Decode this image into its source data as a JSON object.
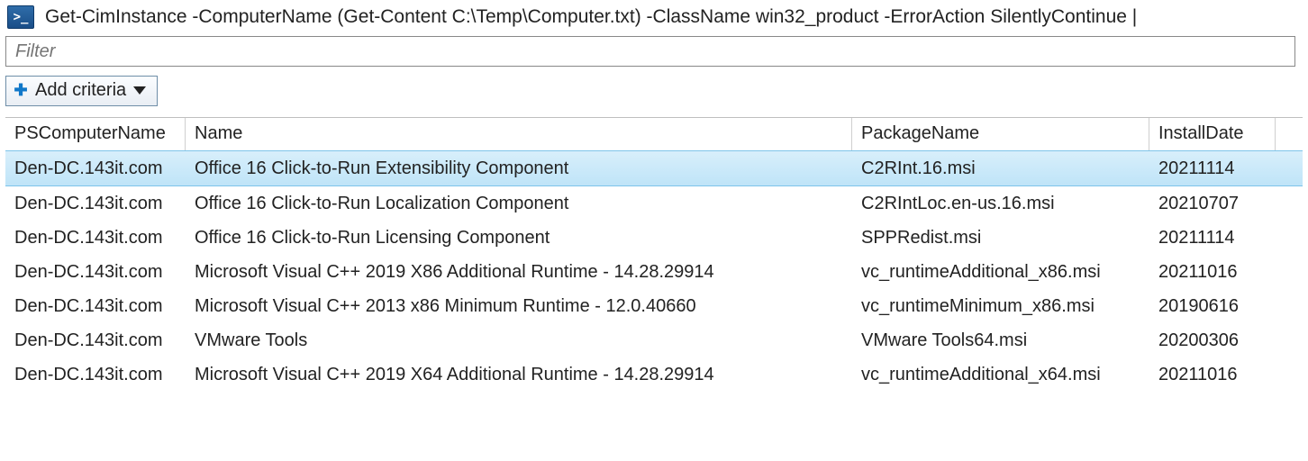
{
  "header": {
    "command": "Get-CimInstance -ComputerName (Get-Content C:\\Temp\\Computer.txt) -ClassName win32_product -ErrorAction SilentlyContinue |"
  },
  "filter": {
    "placeholder": "Filter",
    "value": ""
  },
  "criteria_button": {
    "label": "Add criteria"
  },
  "columns": [
    "PSComputerName",
    "Name",
    "PackageName",
    "InstallDate"
  ],
  "rows": [
    {
      "selected": true,
      "PSComputerName": "Den-DC.143it.com",
      "Name": "Office 16 Click-to-Run Extensibility Component",
      "PackageName": "C2RInt.16.msi",
      "InstallDate": "20211114"
    },
    {
      "selected": false,
      "PSComputerName": "Den-DC.143it.com",
      "Name": "Office 16 Click-to-Run Localization Component",
      "PackageName": "C2RIntLoc.en-us.16.msi",
      "InstallDate": "20210707"
    },
    {
      "selected": false,
      "PSComputerName": "Den-DC.143it.com",
      "Name": "Office 16 Click-to-Run Licensing Component",
      "PackageName": "SPPRedist.msi",
      "InstallDate": "20211114"
    },
    {
      "selected": false,
      "PSComputerName": "Den-DC.143it.com",
      "Name": "Microsoft Visual C++ 2019 X86 Additional Runtime - 14.28.29914",
      "PackageName": "vc_runtimeAdditional_x86.msi",
      "InstallDate": "20211016"
    },
    {
      "selected": false,
      "PSComputerName": "Den-DC.143it.com",
      "Name": "Microsoft Visual C++ 2013 x86 Minimum Runtime - 12.0.40660",
      "PackageName": "vc_runtimeMinimum_x86.msi",
      "InstallDate": "20190616"
    },
    {
      "selected": false,
      "PSComputerName": "Den-DC.143it.com",
      "Name": "VMware Tools",
      "PackageName": "VMware Tools64.msi",
      "InstallDate": "20200306"
    },
    {
      "selected": false,
      "PSComputerName": "Den-DC.143it.com",
      "Name": "Microsoft Visual C++ 2019 X64 Additional Runtime - 14.28.29914",
      "PackageName": "vc_runtimeAdditional_x64.msi",
      "InstallDate": "20211016"
    }
  ]
}
